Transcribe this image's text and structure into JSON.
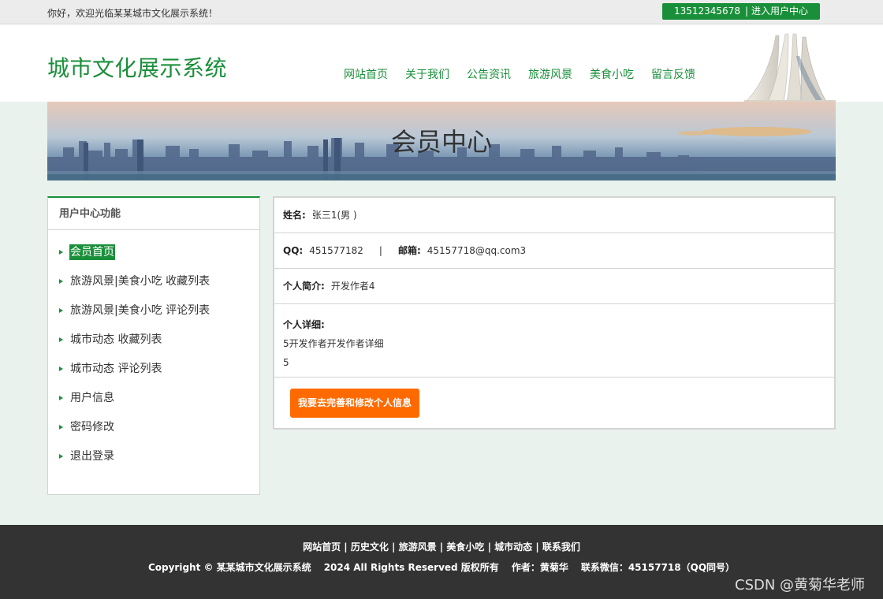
{
  "topbar": {
    "welcome": "你好，欢迎光临某某城市文化展示系统！",
    "phone": "13512345678",
    "user_center": "进入用户中心"
  },
  "header": {
    "logo": "城市文化展示系统",
    "nav": [
      "网站首页",
      "关于我们",
      "公告资讯",
      "旅游风景",
      "美食小吃",
      "留言反馈"
    ]
  },
  "banner": {
    "title": "会员中心"
  },
  "sidebar": {
    "title": "用户中心功能",
    "items": [
      "会员首页",
      "旅游风景|美食小吃 收藏列表",
      "旅游风景|美食小吃 评论列表",
      "城市动态 收藏列表",
      "城市动态 评论列表",
      "用户信息",
      "密码修改",
      "退出登录"
    ],
    "active_index": 0
  },
  "profile": {
    "name_label": "姓名:",
    "name_value": "张三1(男 )",
    "qq_label": "QQ:",
    "qq_value": "451577182",
    "divider": "|",
    "email_label": "邮箱:",
    "email_value": "45157718@qq.com3",
    "intro_label": "个人简介:",
    "intro_value": "开发作者4",
    "detail_label": "个人详细:",
    "detail_line1": "5开发作者开发作者详细",
    "detail_line2": "5",
    "edit_button": "我要去完善和修改个人信息"
  },
  "footer": {
    "links": [
      "网站首页",
      "历史文化",
      "旅游风景",
      "美食小吃",
      "城市动态",
      "联系我们"
    ],
    "link_sep": " | ",
    "copyright": "Copyright © 某某城市文化展示系统",
    "rights": "2024 All Rights Reserved 版权所有",
    "author": "作者：黄菊华",
    "wechat": "联系微信：45157718（QQ同号）",
    "watermark": "CSDN @黄菊华老师"
  },
  "colors": {
    "accent": "#1a8f3a",
    "button": "#ff6a00",
    "footer": "#333333"
  }
}
